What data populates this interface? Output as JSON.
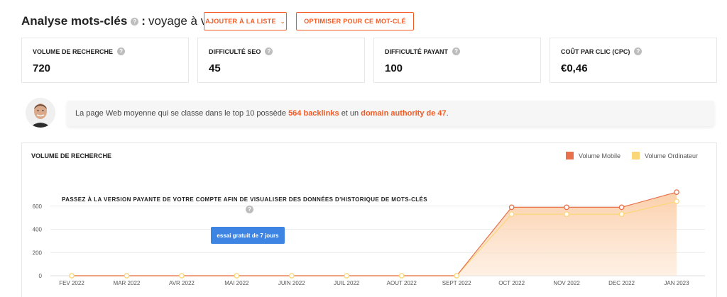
{
  "header": {
    "title": "Analyse mots-clés",
    "help_icon": "question-icon",
    "separator": ":",
    "keyword": "voyage à vélo"
  },
  "buttons": {
    "add_to_list": "AJOUTER À LA LISTE",
    "optimize": "OPTIMISER POUR CE MOT-CLÉ"
  },
  "metrics": [
    {
      "label": "VOLUME DE RECHERCHE",
      "value": "720"
    },
    {
      "label": "DIFFICULTÉ SEO",
      "value": "45"
    },
    {
      "label": "DIFFICULTÉ PAYANT",
      "value": "100"
    },
    {
      "label": "COÛT PAR CLIC (CPC)",
      "value": "€0,46"
    }
  ],
  "tip": {
    "text_before": "La page Web moyenne qui se classe dans le top 10 possède",
    "backlinks": "564 backlinks",
    "text_middle": "et un",
    "authority": "domain authority de 47",
    "text_after": "."
  },
  "chart": {
    "title": "VOLUME DE RECHERCHE",
    "upsell_text": "PASSEZ À LA VERSION PAYANTE DE VOTRE COMPTE AFIN DE VISUALISER DES DONNÉES D'HISTORIQUE DE MOTS-CLÉS",
    "trial_button": "essai gratuit de 7 jours",
    "legend_mobile": "Volume Mobile",
    "legend_desktop": "Volume Ordinateur"
  },
  "colors": {
    "accent": "#f25a24",
    "mobile": "#e8704a",
    "desktop": "#fbd679",
    "trial": "#3d84e3"
  },
  "chart_data": {
    "type": "area",
    "categories": [
      "FEV 2022",
      "MAR 2022",
      "AVR 2022",
      "MAI 2022",
      "JUIN 2022",
      "JUIL 2022",
      "AOUT 2022",
      "SEPT 2022",
      "OCT 2022",
      "NOV 2022",
      "DEC 2022",
      "JAN 2023"
    ],
    "series": [
      {
        "name": "Volume Mobile",
        "values": [
          0,
          0,
          0,
          0,
          0,
          0,
          0,
          0,
          590,
          590,
          590,
          720
        ]
      },
      {
        "name": "Volume Ordinateur",
        "values": [
          0,
          0,
          0,
          0,
          0,
          0,
          0,
          0,
          530,
          530,
          530,
          640
        ]
      }
    ],
    "yticks": [
      0,
      200,
      400,
      600
    ],
    "ylim": [
      0,
      800
    ],
    "grid": true,
    "legend": "top-right"
  }
}
